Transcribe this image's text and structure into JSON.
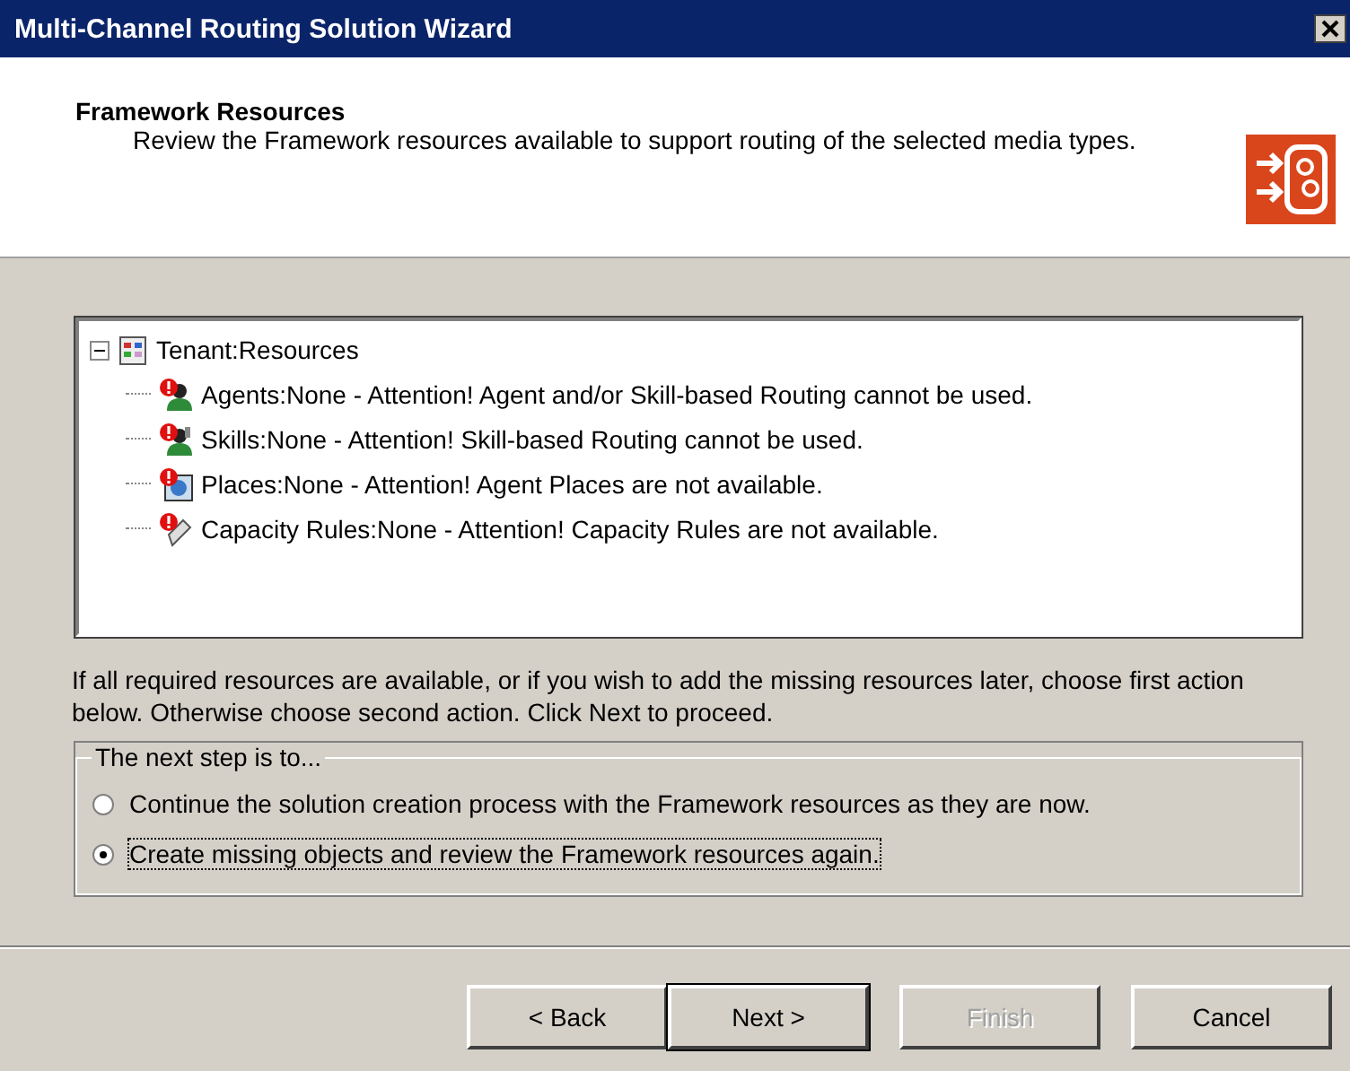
{
  "window": {
    "title": "Multi-Channel Routing Solution Wizard"
  },
  "header": {
    "title": "Framework Resources",
    "subtitle": "Review the Framework resources available to support routing of the selected media types."
  },
  "tree": {
    "label": "Tenant:Resources",
    "expanded": true,
    "children": [
      {
        "kind": "agent",
        "label": "Agents:None - Attention! Agent and/or Skill-based Routing cannot be used."
      },
      {
        "kind": "skill",
        "label": "Skills:None - Attention! Skill-based Routing cannot be used."
      },
      {
        "kind": "place",
        "label": "Places:None - Attention! Agent Places are not available."
      },
      {
        "kind": "capacity",
        "label": "Capacity Rules:None - Attention! Capacity Rules are not available."
      }
    ]
  },
  "instructions": "If all required resources are available, or if you wish to add the missing resources later, choose first action below. Otherwise choose second action. Click Next to proceed.",
  "next_step": {
    "legend": "The next step is to...",
    "options": [
      {
        "label": "Continue the solution creation process with the Framework resources as they are now.",
        "selected": false
      },
      {
        "label": "Create missing objects and review the Framework resources again.",
        "selected": true
      }
    ]
  },
  "buttons": [
    {
      "label": "< Back",
      "disabled": false,
      "default": false
    },
    {
      "label": "Next >",
      "disabled": false,
      "default": true
    },
    {
      "label": "Finish",
      "disabled": true,
      "default": false
    },
    {
      "label": "Cancel",
      "disabled": false,
      "default": false
    }
  ]
}
